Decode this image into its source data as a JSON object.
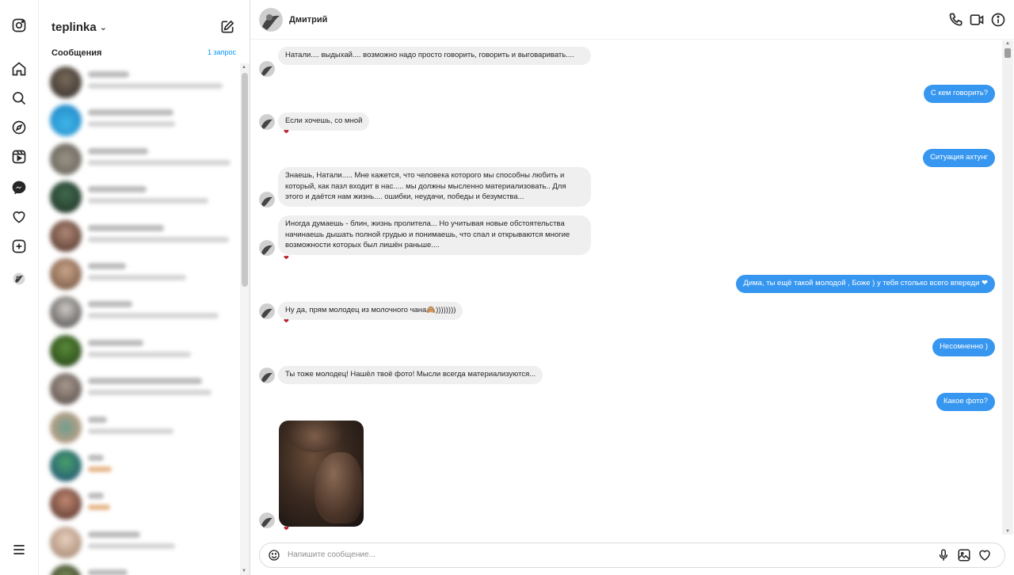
{
  "sidebar_rail": {
    "icons": [
      "instagram-icon",
      "home-icon",
      "search-icon",
      "explore-icon",
      "reels-icon",
      "messenger-icon",
      "heart-icon",
      "create-icon",
      "profile-avatar",
      "menu-icon"
    ]
  },
  "conversations": {
    "account_name": "teplinka",
    "section_title": "Сообщения",
    "requests_link": "1 запрос"
  },
  "chat": {
    "contact_name": "Дмитрий",
    "messages": [
      {
        "dir": "in",
        "text": "Натали.... выдыхай.... возможно надо просто говорить, говорить и выговаривать...."
      },
      {
        "dir": "out",
        "text": "С кем говорить?"
      },
      {
        "dir": "in",
        "text": "Если хочешь, со мной",
        "reaction": "❤"
      },
      {
        "dir": "out",
        "text": "Ситуация ахтунг"
      },
      {
        "dir": "in",
        "text": "Знаешь, Натали..... Мне кажется, что человека которого мы способны любить и который, как пазл входит в нас..... мы должны мысленно материализовать.. Для этого и даётся нам жизнь.... ошибки, неудачи, победы и безумства..."
      },
      {
        "dir": "in",
        "text": "Иногда думаешь - блин, жизнь пролитела...  Но учитывая новые обстоятельства начинаешь дышать полной грудью и понимаешь, что спал и открываются многие возможности которых был лишён раньше....",
        "reaction": "❤"
      },
      {
        "dir": "out",
        "text": "Дима, ты ещё такой молодой , Боже ) у тебя столько всего впереди ❤"
      },
      {
        "dir": "in",
        "text": "Ну да, прям молодец из молочного чана🙈))))))))",
        "reaction": "❤"
      },
      {
        "dir": "out",
        "text": "Несомненно )"
      },
      {
        "dir": "in",
        "text": "Ты тоже молодец! Нашёл твоё фото! Мысли всегда материализуются..."
      },
      {
        "dir": "out",
        "text": "Какое фото?"
      },
      {
        "dir": "in",
        "type": "photo",
        "reaction": "❤"
      }
    ],
    "composer_placeholder": "Напишите сообщение...",
    "colors": {
      "outgoing_bubble": "#3797f0",
      "incoming_bubble": "#efefef",
      "reaction_heart": "#b61e2c"
    }
  }
}
